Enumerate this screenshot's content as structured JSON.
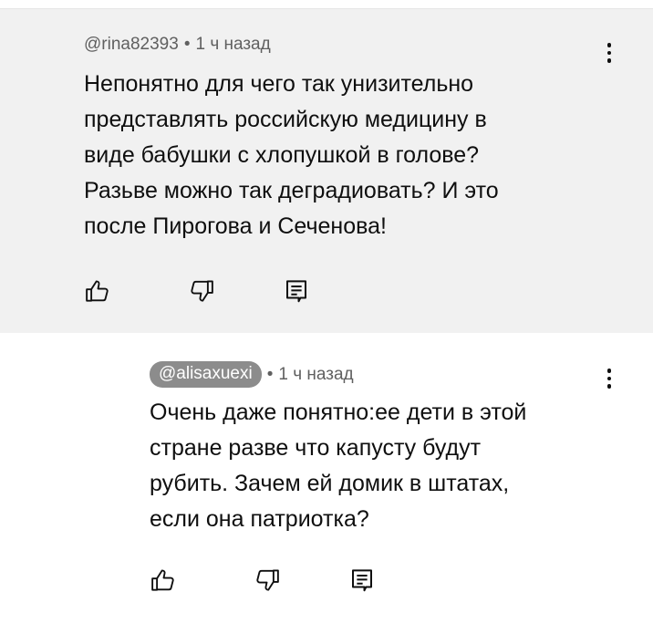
{
  "comments": [
    {
      "author": "@rina82393",
      "separator": "•",
      "time": "1 ч назад",
      "text": "Непонятно для чего так унизительно\nпредставлять российскую медицину в\nвиде бабушки с хлопушкой в голове?\nРазьве можно так  деградиовать? И это\nпосле Пирогова и Сеченова!",
      "actions": [
        "like-icon",
        "dislike-icon",
        "reply-icon"
      ],
      "menu_icon": "more-vert-icon",
      "background": "#f1f1f1"
    },
    {
      "author": "@alisaxuexi",
      "separator": "•",
      "time": "1 ч назад",
      "text": "Очень даже понятно:ее дети в этой\nстране разве что капусту будут\nрубить. Зачем ей домик в штатах,\nесли она патриотка?",
      "actions": [
        "like-icon",
        "dislike-icon",
        "reply-icon"
      ],
      "menu_icon": "more-vert-icon",
      "author_chip_color": "#8c8c8c"
    }
  ]
}
